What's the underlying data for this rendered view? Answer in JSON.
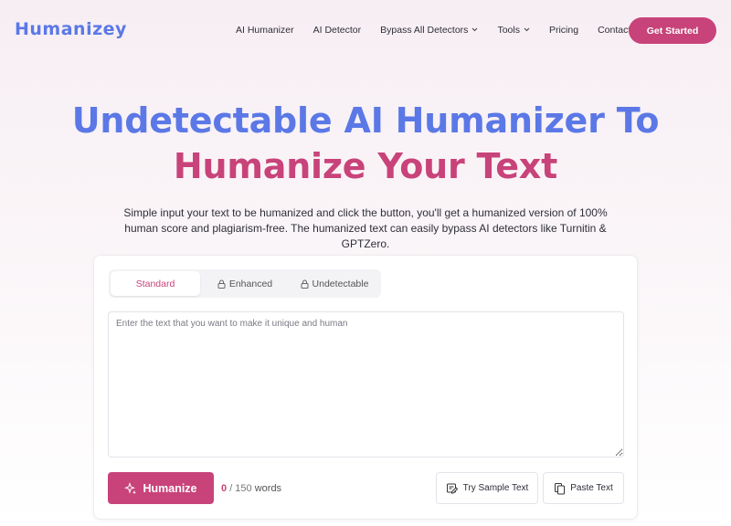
{
  "header": {
    "logo": "Humanizey",
    "nav": [
      {
        "label": "AI Humanizer",
        "dropdown": false
      },
      {
        "label": "AI Detector",
        "dropdown": false
      },
      {
        "label": "Bypass All Detectors",
        "dropdown": true
      },
      {
        "label": "Tools",
        "dropdown": true
      },
      {
        "label": "Pricing",
        "dropdown": false
      },
      {
        "label": "Contact",
        "dropdown": false
      }
    ],
    "cta_label": "Get Started"
  },
  "hero": {
    "title_line1": "Undetectable AI Humanizer To",
    "title_line2": "Humanize Your Text",
    "subtitle": "Simple input your text to be humanized and click the button, you'll get a humanized version of 100% human score and plagiarism-free. The humanized text can easily bypass AI detectors like Turnitin & GPTZero."
  },
  "editor": {
    "tabs": [
      {
        "label": "Standard",
        "active": true,
        "locked": false
      },
      {
        "label": "Enhanced",
        "active": false,
        "locked": true
      },
      {
        "label": "Undetectable",
        "active": false,
        "locked": true
      }
    ],
    "placeholder": "Enter the text that you want to make it unique and human",
    "value": "",
    "humanize_label": "Humanize",
    "word_count": "0",
    "word_max": "/ 150",
    "word_unit": "words",
    "try_sample_label": "Try Sample Text",
    "paste_label": "Paste Text"
  },
  "colors": {
    "brand_blue": "#5b78e6",
    "brand_pink": "#c8437a"
  }
}
